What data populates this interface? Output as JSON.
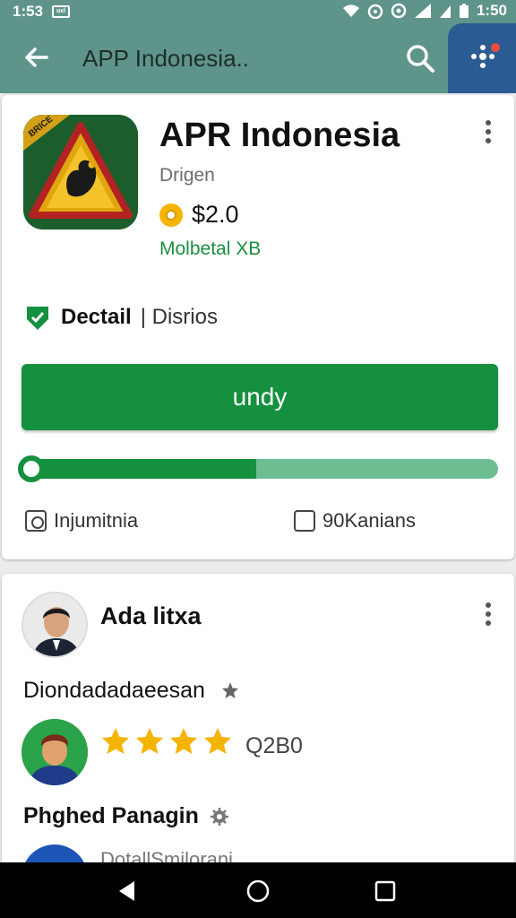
{
  "status": {
    "left_text": "1:53",
    "mini_text": "uxl",
    "time": "1:50"
  },
  "toolbar": {
    "title": "APP Indonesia.."
  },
  "app": {
    "name": "APR Indonesia",
    "developer": "Drigen",
    "price": "$2.0",
    "size": "Molbetal XB",
    "detail_strong": "Dectail",
    "detail_light": "| Disrios",
    "install_label": "undy",
    "progress_fraction": 0.49,
    "option_left": "Injumitnia",
    "option_right": "90Kanians",
    "icon_badge": "BRICE"
  },
  "reviews": {
    "reviewer_name": "Ada litxa",
    "review_text": "Diondadadaeesan",
    "stars": 4,
    "rating_count": "Q2B0",
    "reviewer2_name": "Phghed Panagin",
    "peek_text": "DotallSmilorani"
  },
  "colors": {
    "app_bar": "#5f948a",
    "accent": "#15903f",
    "progress_track": "#6dbd93",
    "side_panel": "#2b5b93",
    "star": "#f5b400"
  }
}
